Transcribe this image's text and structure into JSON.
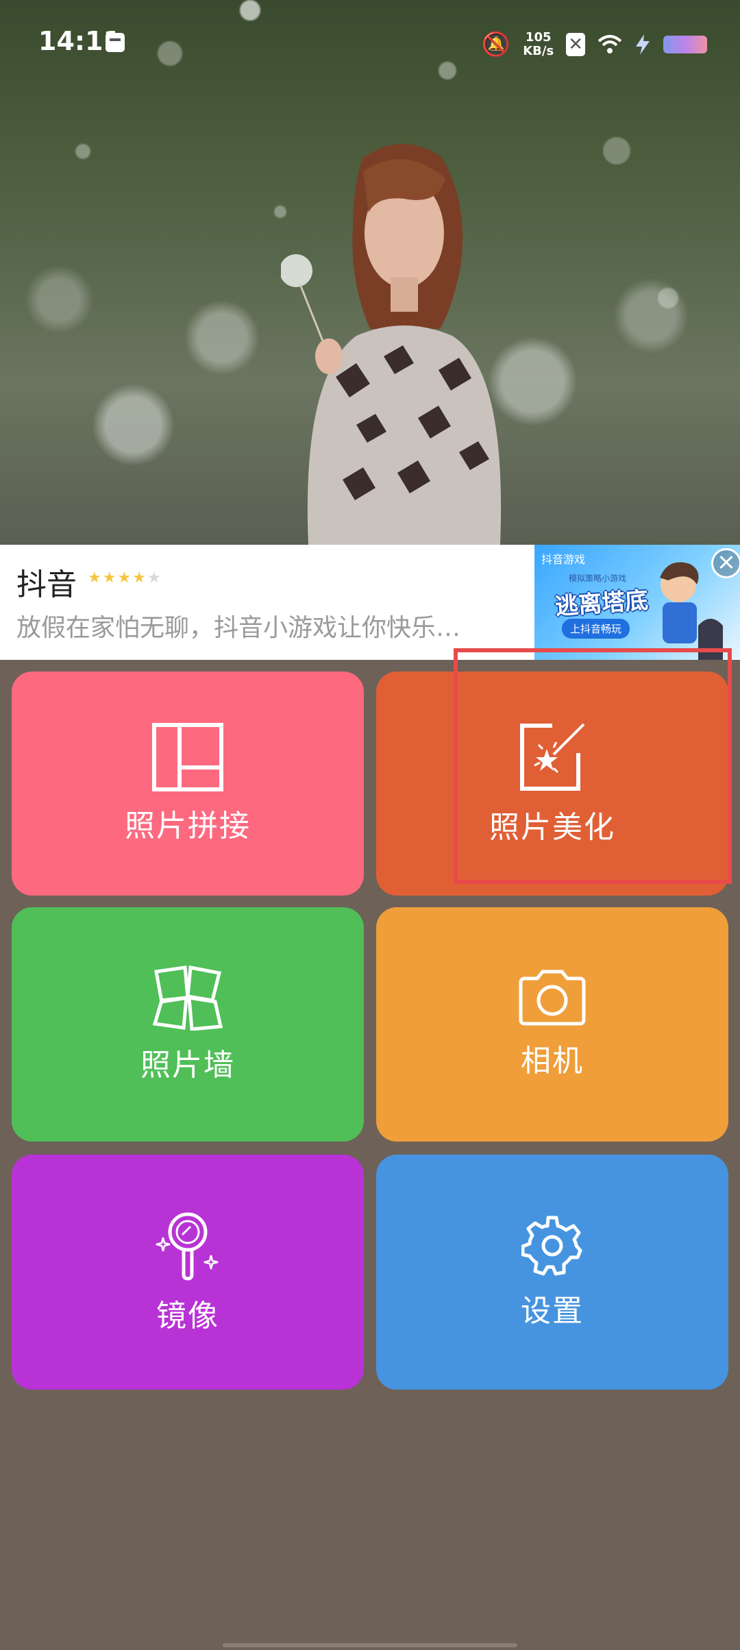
{
  "status_bar": {
    "time": "14:11",
    "net_speed_value": "105",
    "net_speed_unit": "KB/s",
    "icons": [
      "message-icon",
      "mute-bell-icon",
      "close-badge-icon",
      "wifi-icon",
      "charging-icon",
      "battery-icon"
    ]
  },
  "ad": {
    "app_name": "抖音",
    "rating_stars": 4,
    "rating_max": 5,
    "description": "放假在家怕无聊，抖音小游戏让你快乐…",
    "image": {
      "brand": "抖音游戏",
      "subtitle": "模拟策略小游戏",
      "game_title": "逃离塔底",
      "cta": "上抖音畅玩"
    }
  },
  "tiles": [
    {
      "label": "照片拼接",
      "icon": "collage-icon",
      "color": "#fd6a80"
    },
    {
      "label": "照片美化",
      "icon": "magic-wand-icon",
      "color": "#e15f35"
    },
    {
      "label": "照片墙",
      "icon": "photo-wall-icon",
      "color": "#50bf58"
    },
    {
      "label": "相机",
      "icon": "camera-icon",
      "color": "#ef9e3a"
    },
    {
      "label": "镜像",
      "icon": "mirror-icon",
      "color": "#b833d5"
    },
    {
      "label": "设置",
      "icon": "gear-icon",
      "color": "#4694e0"
    }
  ],
  "highlight_color": "#e84b4b"
}
